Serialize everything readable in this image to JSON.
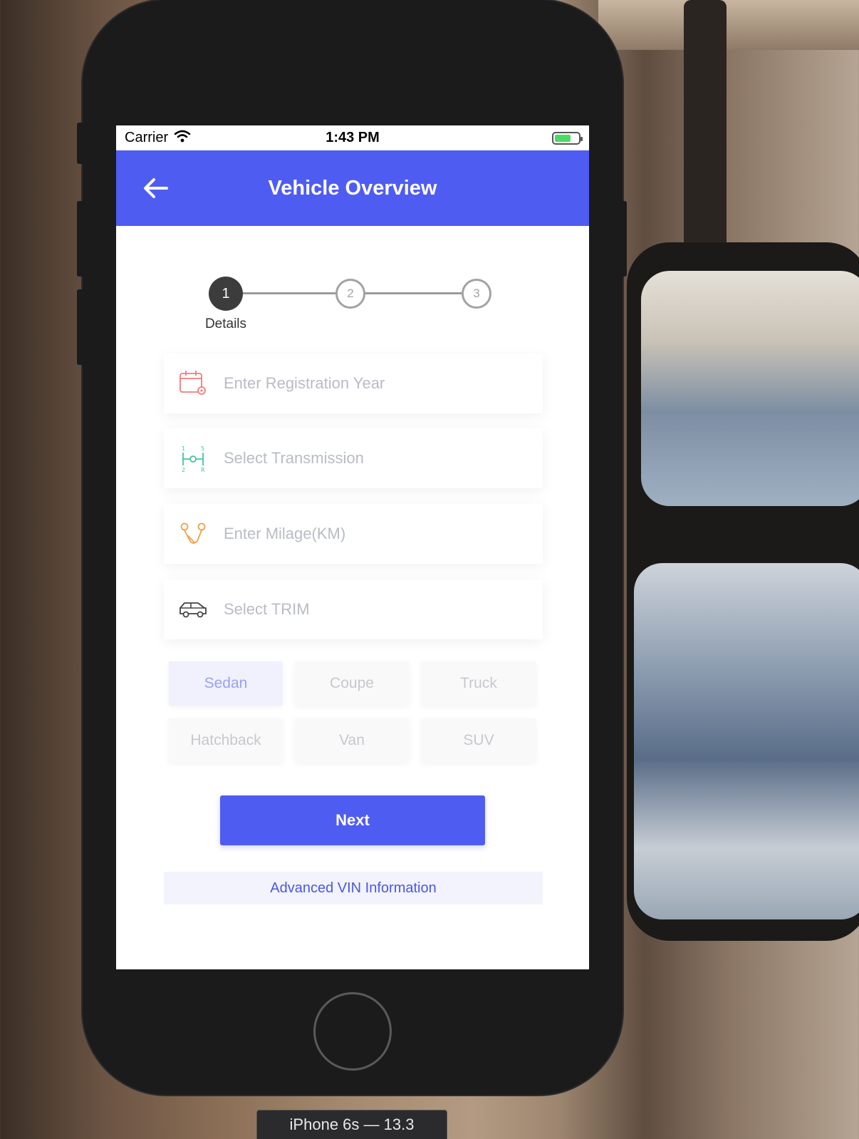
{
  "status_bar": {
    "carrier": "Carrier",
    "time": "1:43 PM"
  },
  "app_bar": {
    "title": "Vehicle Overview",
    "color": "#4f5cf2"
  },
  "stepper": {
    "steps": [
      "1",
      "2",
      "3"
    ],
    "active_step_label": "Details"
  },
  "form": {
    "fields": [
      {
        "placeholder": "Enter Registration Year",
        "icon": "calendar-pin-icon",
        "icon_color": "#f07c7c"
      },
      {
        "placeholder": "Select Transmission",
        "icon": "gear-shift-icon",
        "icon_color": "#3fc79a"
      },
      {
        "placeholder": "Enter Milage(KM)",
        "icon": "route-icon",
        "icon_color": "#f0a04b"
      },
      {
        "placeholder": "Select TRIM",
        "icon": "car-icon",
        "icon_color": "#444444"
      }
    ]
  },
  "body_types": {
    "options": [
      "Sedan",
      "Coupe",
      "Truck",
      "Hatchback",
      "Van",
      "SUV"
    ],
    "selected": "Sedan"
  },
  "actions": {
    "next_label": "Next",
    "vin_label": "Advanced VIN Information"
  },
  "simulator": {
    "device_label": "iPhone 6s — 13.3"
  }
}
